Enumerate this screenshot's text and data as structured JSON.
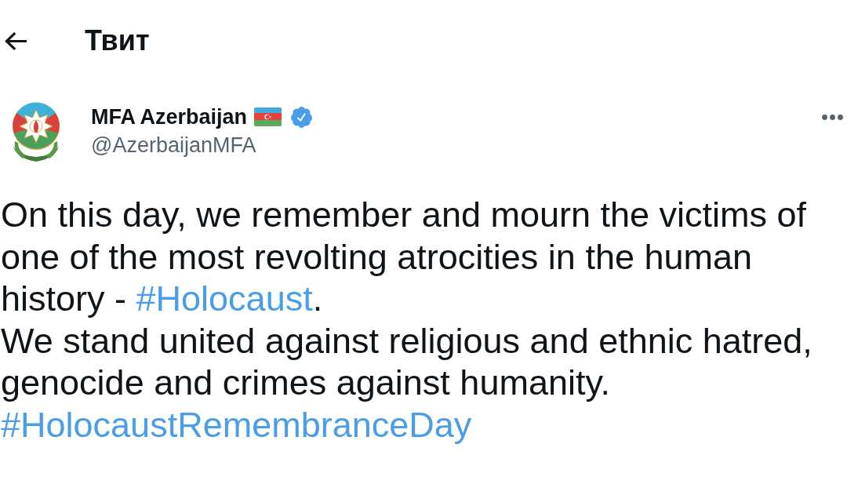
{
  "header": {
    "title": "Твит"
  },
  "tweet": {
    "author": {
      "name": "MFA Azerbaijan",
      "handle": "@AzerbaijanMFA",
      "verified": true
    },
    "paragraphs": [
      {
        "segments": [
          {
            "kind": "text",
            "text": "On this day, we remember and mourn the victims of one of the most revolting atrocities in the human history - "
          },
          {
            "kind": "hashtag",
            "text": "#Holocaust"
          },
          {
            "kind": "text",
            "text": "."
          }
        ]
      },
      {
        "segments": [
          {
            "kind": "text",
            "text": "We stand united against religious and ethnic hatred, genocide and crimes against humanity."
          }
        ]
      },
      {
        "segments": [
          {
            "kind": "hashtag",
            "text": "#HolocaustRemembranceDay"
          }
        ]
      }
    ]
  }
}
